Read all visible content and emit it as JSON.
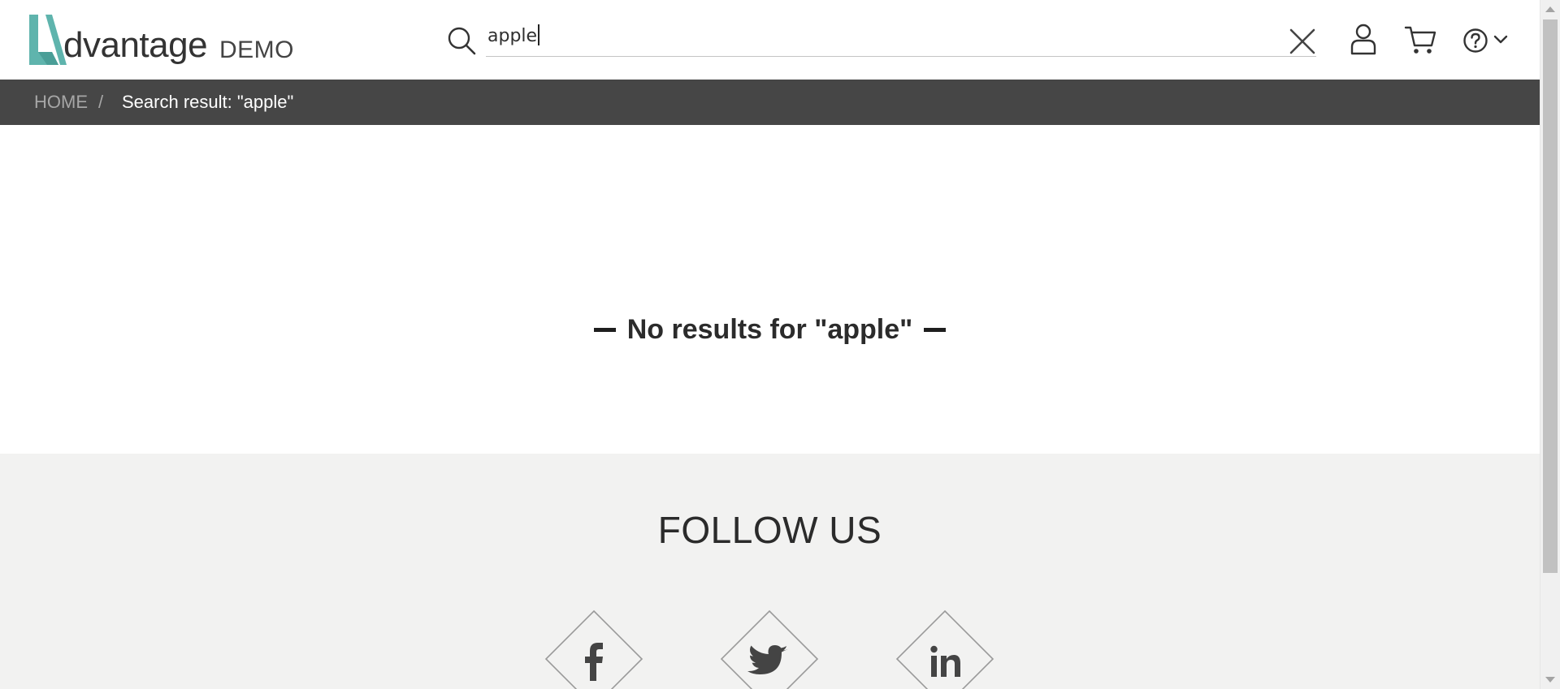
{
  "header": {
    "logo": {
      "wordmark": "dvantage",
      "suffix": "DEMO",
      "accent_color": "#5fb4ad"
    },
    "search": {
      "value": "apple",
      "placeholder": "",
      "icon": "search-icon",
      "clear_icon": "close-icon"
    },
    "icons": {
      "user": "user-icon",
      "cart": "cart-icon",
      "help": "help-icon",
      "help_menu": "chevron-down-icon"
    }
  },
  "breadcrumb": {
    "home": "HOME",
    "separator": "/",
    "current": "Search result: \"apple\""
  },
  "main": {
    "no_results": "No results for \"apple\""
  },
  "footer": {
    "follow_title": "FOLLOW US",
    "social": [
      {
        "name": "facebook",
        "icon": "facebook-icon"
      },
      {
        "name": "twitter",
        "icon": "twitter-icon"
      },
      {
        "name": "linkedin",
        "icon": "linkedin-icon"
      }
    ]
  },
  "colors": {
    "breadcrumb_bg": "#464646",
    "footer_bg": "#f2f2f1",
    "accent": "#5fb4ad"
  }
}
